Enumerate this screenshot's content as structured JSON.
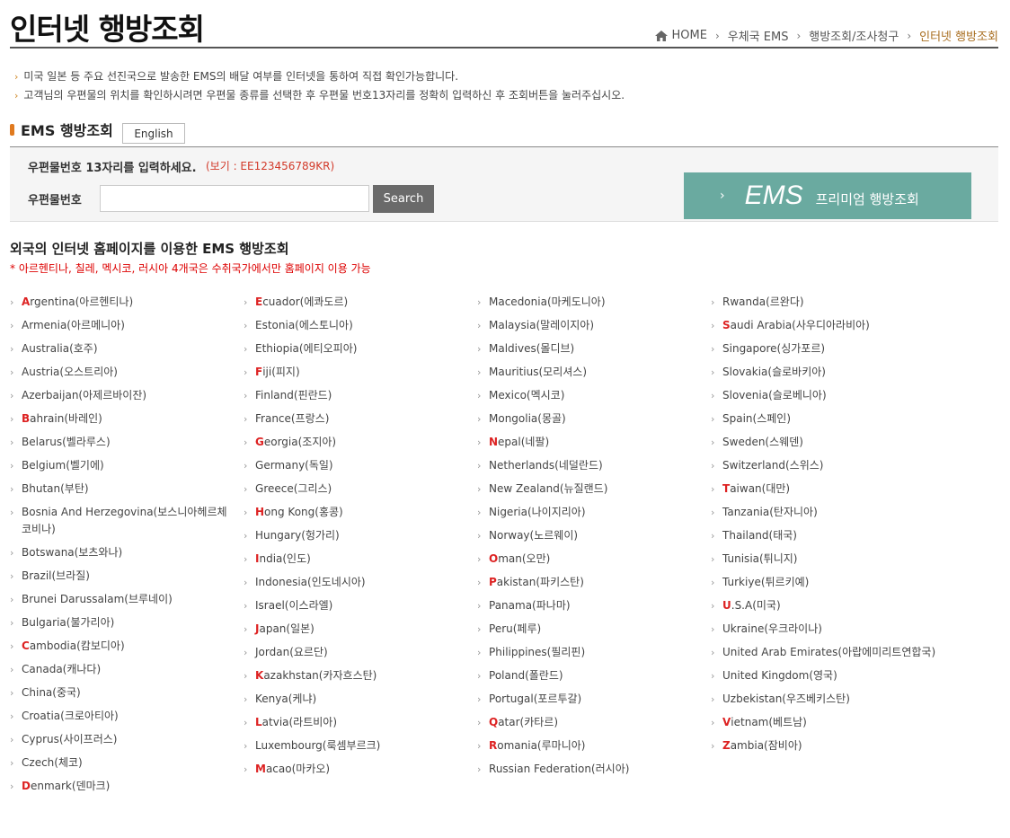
{
  "page_title": "인터넷 행방조회",
  "breadcrumb": {
    "home": "HOME",
    "item1": "우체국 EMS",
    "item2": "행방조회/조사청구",
    "current": "인터넷 행방조회"
  },
  "notes": [
    "미국 일본 등 주요 선진국으로 발송한 EMS의 배달 여부를 인터넷을 통하여 직접 확인가능합니다.",
    "고객님의 우편물의 위치를 확인하시려면 우편물 종류를 선택한 후 우편물 번호13자리를 정확히 입력하신 후 조회버튼을 눌러주십시오."
  ],
  "ems_section": {
    "label": "EMS 행방조회",
    "english_button": "English",
    "instruction": "우편물번호 13자리를 입력하세요.",
    "example": "(보기 : EE123456789KR)",
    "number_label": "우편물번호",
    "input_value": "",
    "search_button": "Search",
    "premium": {
      "chevron": "›",
      "ems": "EMS",
      "text": "프리미엄 행방조회"
    }
  },
  "intl": {
    "title": "외국의 인터넷 홈페이지를 이용한 EMS 행방조회",
    "note": "* 아르헨티나, 칠레, 멕시코, 러시아 4개국은 수취국가에서만 홈페이지 이용 가능"
  },
  "columns": [
    [
      {
        "first": "A",
        "rest": "rgentina(아르헨티나)",
        "hl": true
      },
      {
        "first": "A",
        "rest": "rmenia(아르메니아)",
        "hl": false
      },
      {
        "first": "A",
        "rest": "ustralia(호주)",
        "hl": false
      },
      {
        "first": "A",
        "rest": "ustria(오스트리아)",
        "hl": false
      },
      {
        "first": "A",
        "rest": "zerbaijan(아제르바이잔)",
        "hl": false
      },
      {
        "first": "B",
        "rest": "ahrain(바레인)",
        "hl": true
      },
      {
        "first": "B",
        "rest": "elarus(벨라루스)",
        "hl": false
      },
      {
        "first": "B",
        "rest": "elgium(벨기에)",
        "hl": false
      },
      {
        "first": "B",
        "rest": "hutan(부탄)",
        "hl": false
      },
      {
        "first": "B",
        "rest": "osnia And Herzegovina(보스니아헤르체코비나)",
        "hl": false,
        "wrap": true
      },
      {
        "first": "B",
        "rest": "otswana(보츠와나)",
        "hl": false
      },
      {
        "first": "B",
        "rest": "razil(브라질)",
        "hl": false
      },
      {
        "first": "B",
        "rest": "runei Darussalam(브루네이)",
        "hl": false
      },
      {
        "first": "B",
        "rest": "ulgaria(불가리아)",
        "hl": false
      },
      {
        "first": "C",
        "rest": "ambodia(캄보디아)",
        "hl": true
      },
      {
        "first": "C",
        "rest": "anada(캐나다)",
        "hl": false
      },
      {
        "first": "C",
        "rest": "hina(중국)",
        "hl": false
      },
      {
        "first": "C",
        "rest": "roatia(크로아티아)",
        "hl": false
      },
      {
        "first": "C",
        "rest": "yprus(사이프러스)",
        "hl": false
      },
      {
        "first": "C",
        "rest": "zech(체코)",
        "hl": false
      },
      {
        "first": "D",
        "rest": "enmark(덴마크)",
        "hl": true
      }
    ],
    [
      {
        "first": "E",
        "rest": "cuador(에콰도르)",
        "hl": true
      },
      {
        "first": "E",
        "rest": "stonia(에스토니아)",
        "hl": false
      },
      {
        "first": "E",
        "rest": "thiopia(에티오피아)",
        "hl": false
      },
      {
        "first": "F",
        "rest": "iji(피지)",
        "hl": true
      },
      {
        "first": "F",
        "rest": "inland(핀란드)",
        "hl": false
      },
      {
        "first": "F",
        "rest": "rance(프랑스)",
        "hl": false
      },
      {
        "first": "G",
        "rest": "eorgia(조지아)",
        "hl": true
      },
      {
        "first": "G",
        "rest": "ermany(독일)",
        "hl": false
      },
      {
        "first": "G",
        "rest": "reece(그리스)",
        "hl": false
      },
      {
        "first": "H",
        "rest": "ong Kong(홍콩)",
        "hl": true
      },
      {
        "first": "H",
        "rest": "ungary(헝가리)",
        "hl": false
      },
      {
        "first": "I",
        "rest": "ndia(인도)",
        "hl": true
      },
      {
        "first": "I",
        "rest": "ndonesia(인도네시아)",
        "hl": false
      },
      {
        "first": "I",
        "rest": "srael(이스라엘)",
        "hl": false
      },
      {
        "first": "J",
        "rest": "apan(일본)",
        "hl": true
      },
      {
        "first": "J",
        "rest": "ordan(요르단)",
        "hl": false
      },
      {
        "first": "K",
        "rest": "azakhstan(카자흐스탄)",
        "hl": true
      },
      {
        "first": "K",
        "rest": "enya(케냐)",
        "hl": false
      },
      {
        "first": "L",
        "rest": "atvia(라트비아)",
        "hl": true
      },
      {
        "first": "L",
        "rest": "uxembourg(룩셈부르크)",
        "hl": false
      },
      {
        "first": "M",
        "rest": "acao(마카오)",
        "hl": true
      }
    ],
    [
      {
        "first": "M",
        "rest": "acedonia(마케도니아)",
        "hl": false
      },
      {
        "first": "M",
        "rest": "alaysia(말레이지아)",
        "hl": false
      },
      {
        "first": "M",
        "rest": "aldives(몰디브)",
        "hl": false
      },
      {
        "first": "M",
        "rest": "auritius(모리셔스)",
        "hl": false
      },
      {
        "first": "M",
        "rest": "exico(멕시코)",
        "hl": false
      },
      {
        "first": "M",
        "rest": "ongolia(몽골)",
        "hl": false
      },
      {
        "first": "N",
        "rest": "epal(네팔)",
        "hl": true
      },
      {
        "first": "N",
        "rest": "etherlands(네덜란드)",
        "hl": false
      },
      {
        "first": "N",
        "rest": "ew Zealand(뉴질랜드)",
        "hl": false
      },
      {
        "first": "N",
        "rest": "igeria(나이지리아)",
        "hl": false
      },
      {
        "first": "N",
        "rest": "orway(노르웨이)",
        "hl": false
      },
      {
        "first": "O",
        "rest": "man(오만)",
        "hl": true
      },
      {
        "first": "P",
        "rest": "akistan(파키스탄)",
        "hl": true
      },
      {
        "first": "P",
        "rest": "anama(파나마)",
        "hl": false
      },
      {
        "first": "P",
        "rest": "eru(페루)",
        "hl": false
      },
      {
        "first": "P",
        "rest": "hilippines(필리핀)",
        "hl": false
      },
      {
        "first": "P",
        "rest": "oland(폴란드)",
        "hl": false
      },
      {
        "first": "P",
        "rest": "ortugal(포르투갈)",
        "hl": false
      },
      {
        "first": "Q",
        "rest": "atar(카타르)",
        "hl": true
      },
      {
        "first": "R",
        "rest": "omania(루마니아)",
        "hl": true
      },
      {
        "first": "R",
        "rest": "ussian Federation(러시아)",
        "hl": false
      }
    ],
    [
      {
        "first": "R",
        "rest": "wanda(르완다)",
        "hl": false
      },
      {
        "first": "S",
        "rest": "audi Arabia(사우디아라비아)",
        "hl": true
      },
      {
        "first": "S",
        "rest": "ingapore(싱가포르)",
        "hl": false
      },
      {
        "first": "S",
        "rest": "lovakia(슬로바키아)",
        "hl": false
      },
      {
        "first": "S",
        "rest": "lovenia(슬로베니아)",
        "hl": false
      },
      {
        "first": "S",
        "rest": "pain(스페인)",
        "hl": false
      },
      {
        "first": "S",
        "rest": "weden(스웨덴)",
        "hl": false
      },
      {
        "first": "S",
        "rest": "witzerland(스위스)",
        "hl": false
      },
      {
        "first": "T",
        "rest": "aiwan(대만)",
        "hl": true
      },
      {
        "first": "T",
        "rest": "anzania(탄자니아)",
        "hl": false
      },
      {
        "first": "T",
        "rest": "hailand(태국)",
        "hl": false
      },
      {
        "first": "T",
        "rest": "unisia(튀니지)",
        "hl": false
      },
      {
        "first": "T",
        "rest": "urkiye(튀르키예)",
        "hl": false
      },
      {
        "first": "U",
        "rest": ".S.A(미국)",
        "hl": true
      },
      {
        "first": "U",
        "rest": "kraine(우크라이나)",
        "hl": false
      },
      {
        "first": "U",
        "rest": "nited Arab Emirates(아랍에미리트연합국)",
        "hl": false
      },
      {
        "first": "U",
        "rest": "nited Kingdom(영국)",
        "hl": false
      },
      {
        "first": "U",
        "rest": "zbekistan(우즈베키스탄)",
        "hl": false
      },
      {
        "first": "V",
        "rest": "ietnam(베트남)",
        "hl": true
      },
      {
        "first": "Z",
        "rest": "ambia(잠비아)",
        "hl": true
      }
    ]
  ]
}
